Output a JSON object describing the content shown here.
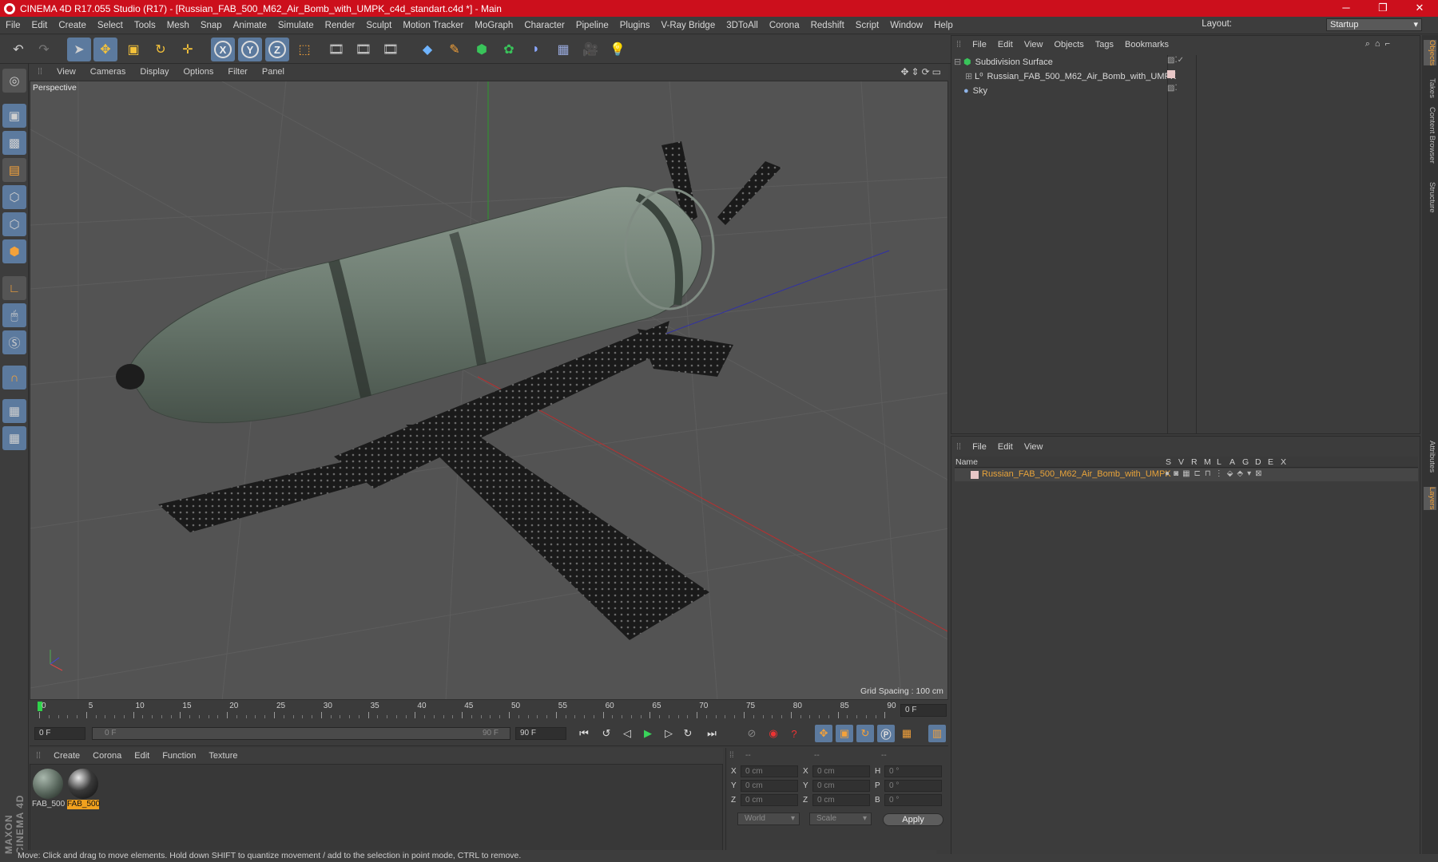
{
  "window": {
    "title": "CINEMA 4D R17.055 Studio (R17) - [Russian_FAB_500_M62_Air_Bomb_with_UMPK_c4d_standart.c4d *] - Main"
  },
  "menubar": [
    "File",
    "Edit",
    "Create",
    "Select",
    "Tools",
    "Mesh",
    "Snap",
    "Animate",
    "Simulate",
    "Render",
    "Sculpt",
    "Motion Tracker",
    "MoGraph",
    "Character",
    "Pipeline",
    "Plugins",
    "V-Ray Bridge",
    "3DToAll",
    "Corona",
    "Redshift",
    "Script",
    "Window",
    "Help"
  ],
  "layout": {
    "label": "Layout:",
    "value": "Startup"
  },
  "viewport": {
    "menu": [
      "View",
      "Cameras",
      "Display",
      "Options",
      "Filter",
      "Panel"
    ],
    "name": "Perspective",
    "grid_spacing": "Grid Spacing : 100 cm"
  },
  "timeline": {
    "ticks": [
      "0",
      "5",
      "10",
      "15",
      "20",
      "25",
      "30",
      "35",
      "40",
      "45",
      "50",
      "55",
      "60",
      "65",
      "70",
      "75",
      "80",
      "85",
      "90"
    ],
    "frame_field": "0 F",
    "start": "0 F",
    "range_start": "0 F",
    "range_end": "90 F",
    "end": "90 F"
  },
  "materials": {
    "menu": [
      "Create",
      "Corona",
      "Edit",
      "Function",
      "Texture"
    ],
    "items": [
      {
        "label": "FAB_500",
        "selected": false
      },
      {
        "label": "FAB_500",
        "selected": true
      }
    ]
  },
  "coords": {
    "headers": [
      "--",
      "--",
      "--"
    ],
    "rows": [
      {
        "a": "X",
        "v1": "0 cm",
        "b": "X",
        "v2": "0 cm",
        "c": "H",
        "v3": "0 °"
      },
      {
        "a": "Y",
        "v1": "0 cm",
        "b": "Y",
        "v2": "0 cm",
        "c": "P",
        "v3": "0 °"
      },
      {
        "a": "Z",
        "v1": "0 cm",
        "b": "Z",
        "v2": "0 cm",
        "c": "B",
        "v3": "0 °"
      }
    ],
    "mode": "World",
    "mode2": "Scale",
    "apply": "Apply"
  },
  "objects": {
    "menu": [
      "File",
      "Edit",
      "View",
      "Objects",
      "Tags",
      "Bookmarks"
    ],
    "items": [
      "Subdivision Surface",
      "Russian_FAB_500_M62_Air_Bomb_with_UMPK",
      "Sky"
    ]
  },
  "layers": {
    "menu": [
      "File",
      "Edit",
      "View"
    ],
    "columns": [
      "Name",
      "S",
      "V",
      "R",
      "M",
      "L",
      "A",
      "G",
      "D",
      "E",
      "X"
    ],
    "row": "Russian_FAB_500_M62_Air_Bomb_with_UMPK"
  },
  "right_tabs": [
    "Objects",
    "Takes",
    "Content Browser",
    "Structure",
    "Attributes",
    "Layers"
  ],
  "status": "Move: Click and drag to move elements. Hold down SHIFT to quantize movement / add to the selection in point mode, CTRL to remove.",
  "brand": "MAXON CINEMA 4D",
  "colors": {
    "title_bar": "#cc0f1c",
    "selected_tool": "#5c7a9e",
    "layer_name": "#e8a33a",
    "viewport_bg": "#535353"
  }
}
